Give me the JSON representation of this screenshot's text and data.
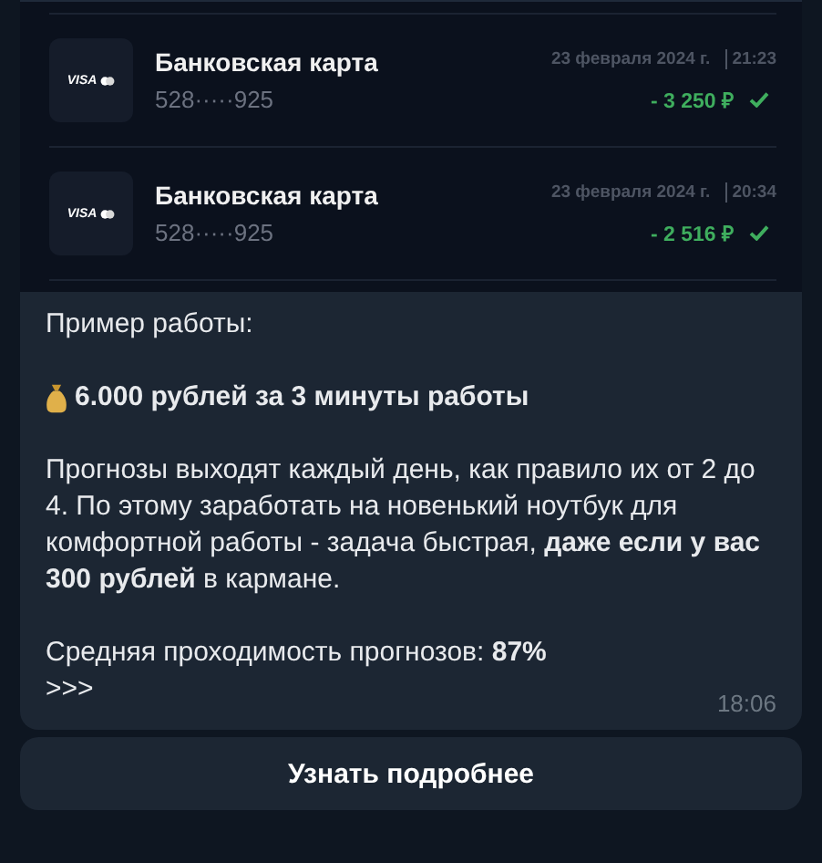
{
  "transactions": [
    {
      "card_brand": "VISA",
      "title": "Банковская карта",
      "number": "528·····925",
      "date": "23 февраля 2024 г.",
      "time": "21:23",
      "amount": "- 3 250 ₽",
      "completed": true
    },
    {
      "card_brand": "VISA",
      "title": "Банковская карта",
      "number": "528·····925",
      "date": "23 февраля 2024 г.",
      "time": "20:34",
      "amount": "- 2 516 ₽",
      "completed": true
    }
  ],
  "message": {
    "paragraphs": [
      {
        "kind": "plain",
        "text": "Пример работы:"
      },
      {
        "kind": "money",
        "text": "6.000 рублей за 3 минуты работы"
      },
      {
        "kind": "plain",
        "text": "Прогнозы выходят каждый день, как правило их от 2 до 4. По этому заработать на новенький ноутбук для комфортной работы - задача быстрая, **даже если у вас 300 рублей** в кармане."
      },
      {
        "kind": "plain",
        "text": "Средняя проходимость прогнозов: **87%**"
      },
      {
        "kind": "tight",
        "text": ">>>"
      }
    ],
    "time": "18:06"
  },
  "button": "Узнать подробнее"
}
